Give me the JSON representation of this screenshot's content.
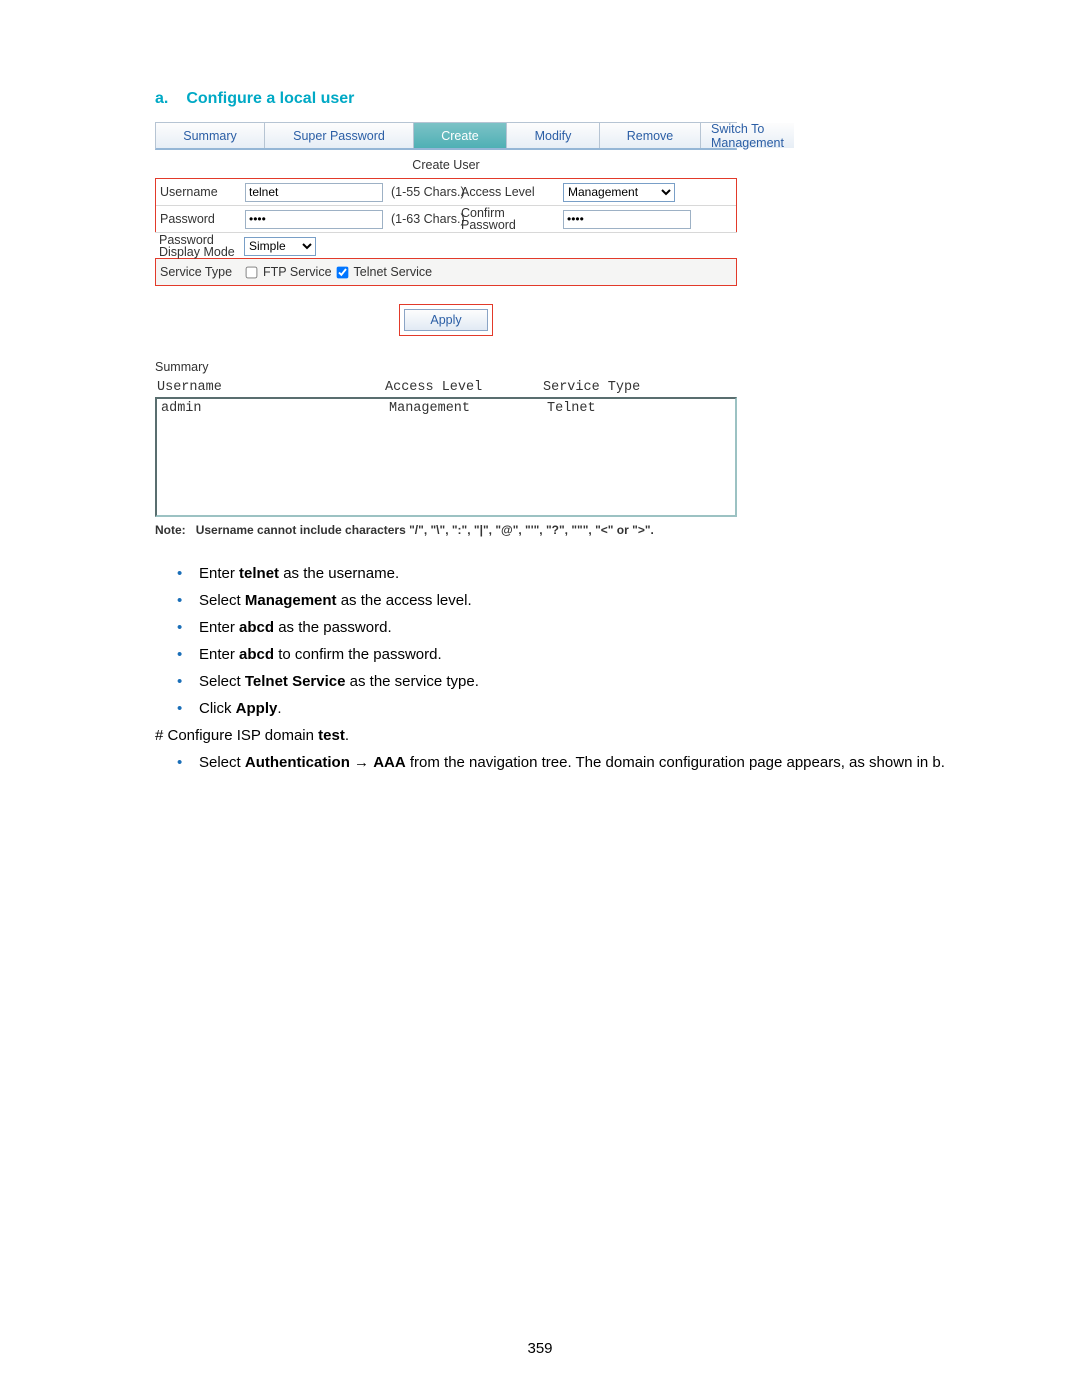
{
  "heading": {
    "letter": "a.",
    "title": "Configure a local user"
  },
  "tabs": {
    "summary": "Summary",
    "superPassword": "Super Password",
    "create": "Create",
    "modify": "Modify",
    "remove": "Remove",
    "switch": "Switch To Management"
  },
  "form": {
    "title": "Create User",
    "usernameLabel": "Username",
    "usernameValue": "telnet",
    "usernameHint": "(1-55 Chars.)",
    "accessLabel": "Access Level",
    "accessValue": "Management",
    "passwordLabel": "Password",
    "passwordValue": "••••",
    "passwordHint": "(1-63 Chars.)",
    "confirmLabel": "Confirm Password",
    "confirmValue": "••••",
    "modeLabel": "Password Display Mode",
    "modeValue": "Simple",
    "serviceLabel": "Service Type",
    "ftp": "FTP Service",
    "telnet": "Telnet Service",
    "apply": "Apply"
  },
  "summary": {
    "title": "Summary",
    "h1": "Username",
    "h2": "Access Level",
    "h3": "Service Type",
    "r1c1": "admin",
    "r1c2": "Management",
    "r1c3": "Telnet"
  },
  "note": {
    "label": "Note:",
    "text": "Username cannot include characters \"/\", \"\\\", \":\", \"|\", \"@\", \"'\", \"?\", \"\"\", \"<\" or \">\"."
  },
  "bullets": {
    "b1a": "Enter ",
    "b1b": "telnet",
    "b1c": " as the username.",
    "b2a": "Select ",
    "b2b": "Management",
    "b2c": " as the access level.",
    "b3a": "Enter ",
    "b3b": "abcd",
    "b3c": " as the password.",
    "b4a": "Enter ",
    "b4b": "abcd",
    "b4c": " to confirm the password.",
    "b5a": "Select ",
    "b5b": "Telnet Service",
    "b5c": " as the service type.",
    "b6a": "Click ",
    "b6b": "Apply",
    "b6c": ".",
    "p1a": "# Configure ISP domain ",
    "p1b": "test",
    "p1c": ".",
    "b7a": "Select ",
    "b7b": "Authentication",
    "b7arrow": " → ",
    "b7c": "AAA",
    "b7d": " from the navigation tree. The domain configuration page appears, as shown in ",
    "b7ref": "b",
    "b7e": "."
  },
  "pageNumber": "359"
}
